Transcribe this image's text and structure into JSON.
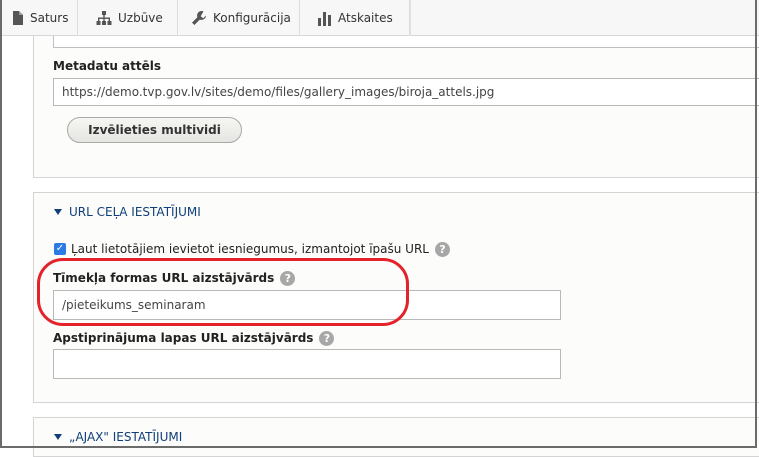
{
  "toolbar": {
    "items": [
      {
        "label": "Saturs",
        "icon": "document-icon"
      },
      {
        "label": "Uzbūve",
        "icon": "sitemap-icon"
      },
      {
        "label": "Konfigurācija",
        "icon": "wrench-icon"
      },
      {
        "label": "Atskaites",
        "icon": "bar-chart-icon"
      }
    ]
  },
  "metadata_image": {
    "label": "Metadatu attēls",
    "value": "https://demo.tvp.gov.lv/sites/demo/files/gallery_images/biroja_attels.jpg",
    "button_label": "Izvēlieties multividi"
  },
  "url_settings": {
    "heading": "URL CEĻA IESTATĪJUMI",
    "checkbox_label": "Ļaut lietotājiem ievietot iesniegumus, izmantojot īpašu URL",
    "checkbox_checked": true,
    "webform_url_label": "Tīmekļa formas URL aizstājvārds",
    "webform_url_value": "/pieteikums_seminaram",
    "confirmation_url_label": "Apstiprinājuma lapas URL aizstājvārds",
    "confirmation_url_value": ""
  },
  "ajax_settings": {
    "heading": "„AJAX\" IESTATĪJUMI"
  },
  "colors": {
    "annotation": "#e3222b",
    "heading_link": "#0f3f79",
    "checkbox": "#2c7be5"
  }
}
